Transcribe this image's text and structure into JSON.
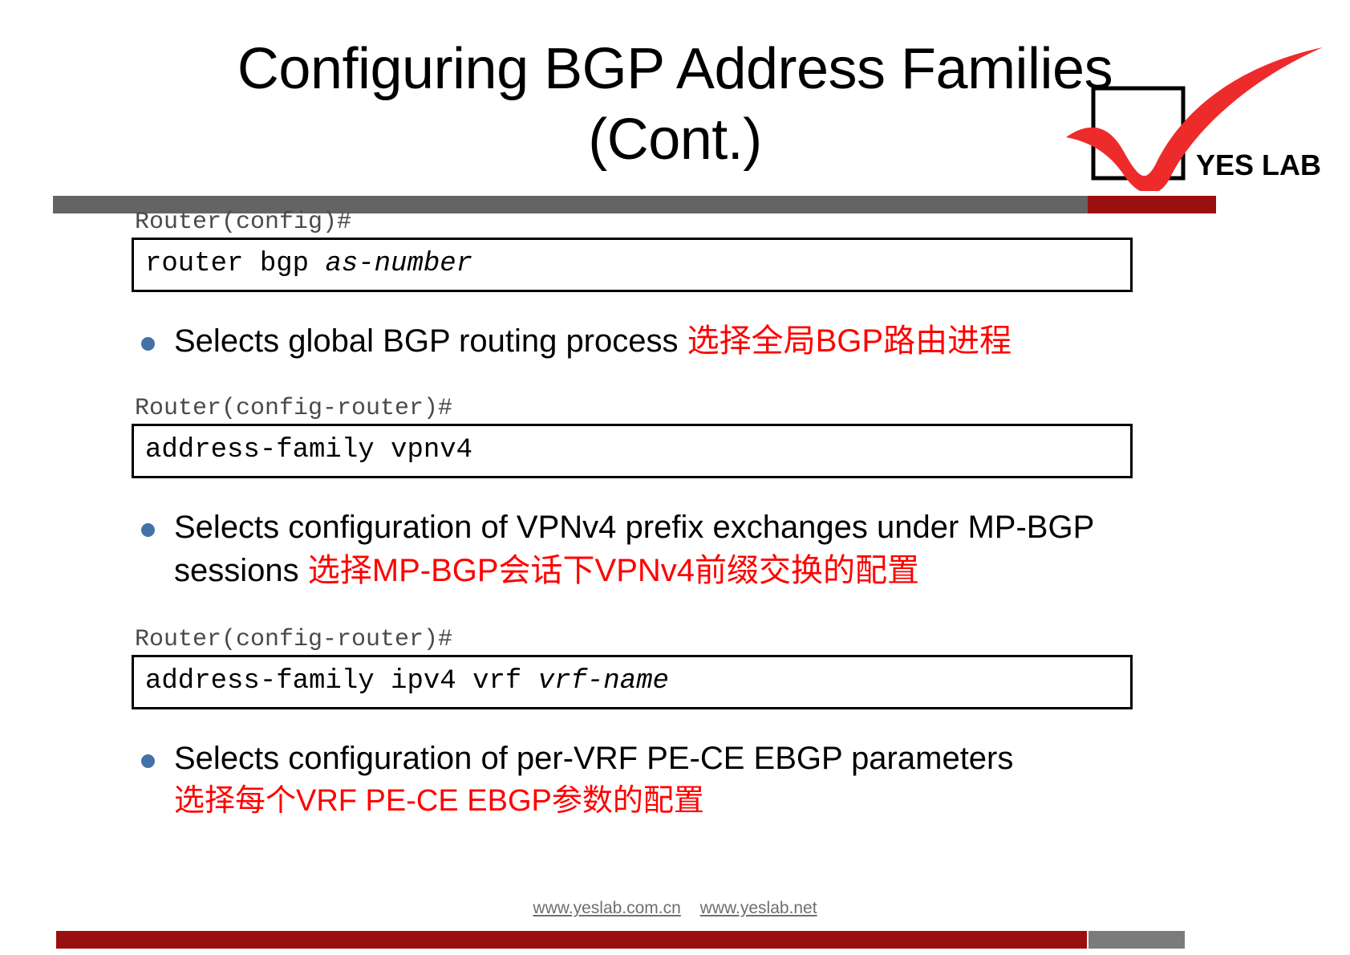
{
  "slide": {
    "title_lines": [
      "Configuring BGP Address Families",
      "(Cont.)"
    ],
    "logo_text": "YES LAB",
    "accent_red": "#9a0f0f",
    "bullet_blue": "#4472a8",
    "cn_red": "#ff0000",
    "bar_gray": "#646464"
  },
  "blocks": [
    {
      "prompt": "Router(config)#",
      "cmd_main": "router bgp ",
      "cmd_param": "as-number",
      "bullet_en": "Selects global BGP routing process ",
      "bullet_cn": "选择全局BGP路由进程",
      "bullet_cn_second_line": ""
    },
    {
      "prompt": "Router(config-router)#",
      "cmd_main": "address-family vpnv4",
      "cmd_param": "",
      "bullet_en": "Selects configuration of VPNv4 prefix exchanges under MP-BGP sessions ",
      "bullet_cn": "选择MP-BGP会话下VPNv4前缀交换的配置",
      "bullet_cn_second_line": ""
    },
    {
      "prompt": "Router(config-router)#",
      "cmd_main": "address-family ipv4 vrf ",
      "cmd_param": "vrf-name",
      "bullet_en": "Selects configuration of per-VRF PE-CE EBGP parameters",
      "bullet_cn": "",
      "bullet_cn_second_line": "选择每个VRF PE-CE EBGP参数的配置"
    }
  ],
  "footer": {
    "link1": "www.yeslab.com.cn",
    "link2": "www.yeslab.net"
  }
}
